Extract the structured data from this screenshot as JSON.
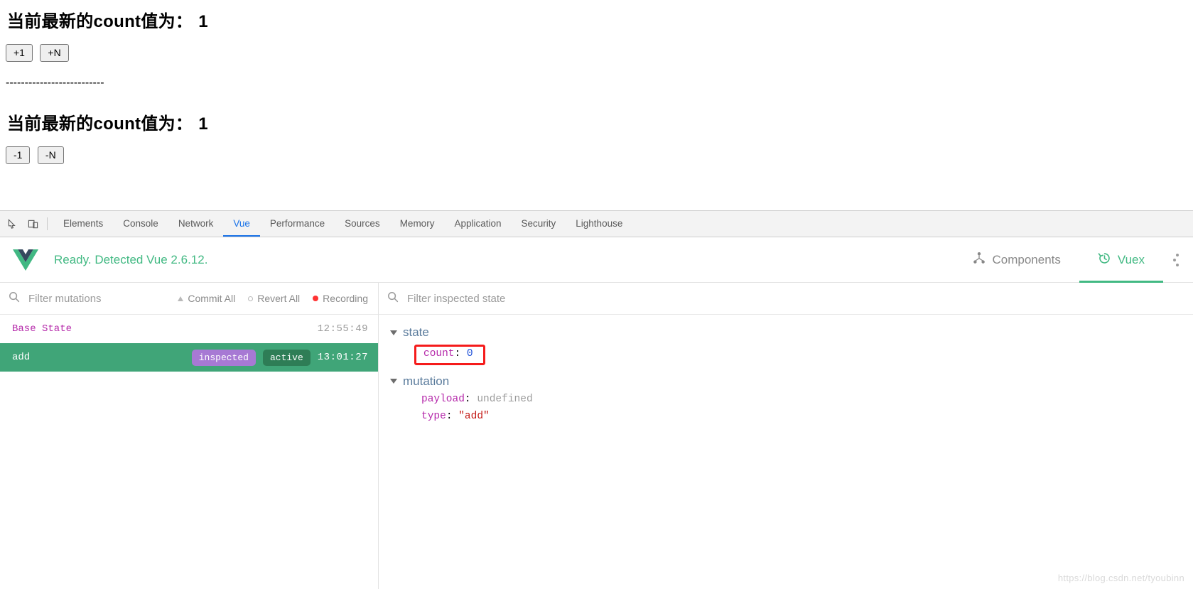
{
  "app": {
    "heading_top": "当前最新的count值为：",
    "count_top": "1",
    "buttons_top": [
      {
        "label": "+1",
        "name": "increment-by-one-button"
      },
      {
        "label": "+N",
        "name": "increment-by-n-button"
      }
    ],
    "divider": "--------------------------",
    "heading_bottom": "当前最新的count值为：",
    "count_bottom": "1",
    "buttons_bottom": [
      {
        "label": "-1",
        "name": "decrement-by-one-button"
      },
      {
        "label": "-N",
        "name": "decrement-by-n-button"
      }
    ]
  },
  "devtools": {
    "tabs": [
      {
        "label": "Elements",
        "active": false
      },
      {
        "label": "Console",
        "active": false
      },
      {
        "label": "Network",
        "active": false
      },
      {
        "label": "Vue",
        "active": true
      },
      {
        "label": "Performance",
        "active": false
      },
      {
        "label": "Sources",
        "active": false
      },
      {
        "label": "Memory",
        "active": false
      },
      {
        "label": "Application",
        "active": false
      },
      {
        "label": "Security",
        "active": false
      },
      {
        "label": "Lighthouse",
        "active": false
      }
    ],
    "inspect_icon": "inspect-element-icon",
    "device_icon": "device-toolbar-icon",
    "accent_color": "#1a73e8"
  },
  "vue_devtools": {
    "status": "Ready. Detected Vue 2.6.12.",
    "logo_icon": "vue-logo-icon",
    "accent_color": "#42b983",
    "panel_tabs": [
      {
        "label": "Components",
        "icon": "components-tree-icon",
        "active": false
      },
      {
        "label": "Vuex",
        "icon": "vuex-history-icon",
        "active": true
      }
    ],
    "more_menu_icon": "kebab-menu-icon"
  },
  "mutations_pane": {
    "filter_placeholder": "Filter mutations",
    "filter_value": "",
    "search_icon": "search-icon",
    "actions": [
      {
        "label": "Commit All",
        "icon": "commit-icon"
      },
      {
        "label": "Revert All",
        "icon": "revert-icon"
      },
      {
        "label": "Recording",
        "icon": "record-dot-icon"
      }
    ],
    "rows": [
      {
        "label": "Base State",
        "time": "12:55:49",
        "active": false,
        "badges": []
      },
      {
        "label": "add",
        "time": "13:01:27",
        "active": true,
        "badges": [
          {
            "text": "inspected",
            "kind": "inspected"
          },
          {
            "text": "active",
            "kind": "active"
          }
        ]
      }
    ]
  },
  "inspector_pane": {
    "filter_placeholder": "Filter inspected state",
    "filter_value": "",
    "search_icon": "search-icon",
    "groups": [
      {
        "title": "state",
        "entries": [
          {
            "key": "count",
            "value": "0",
            "value_type": "num",
            "highlighted": true
          }
        ]
      },
      {
        "title": "mutation",
        "entries": [
          {
            "key": "payload",
            "value": "undefined",
            "value_type": "undef",
            "highlighted": false
          },
          {
            "key": "type",
            "value": "\"add\"",
            "value_type": "str",
            "highlighted": false
          }
        ]
      }
    ],
    "highlight_color": "#f51b1b"
  },
  "watermark": "https://blog.csdn.net/tyoubinn"
}
